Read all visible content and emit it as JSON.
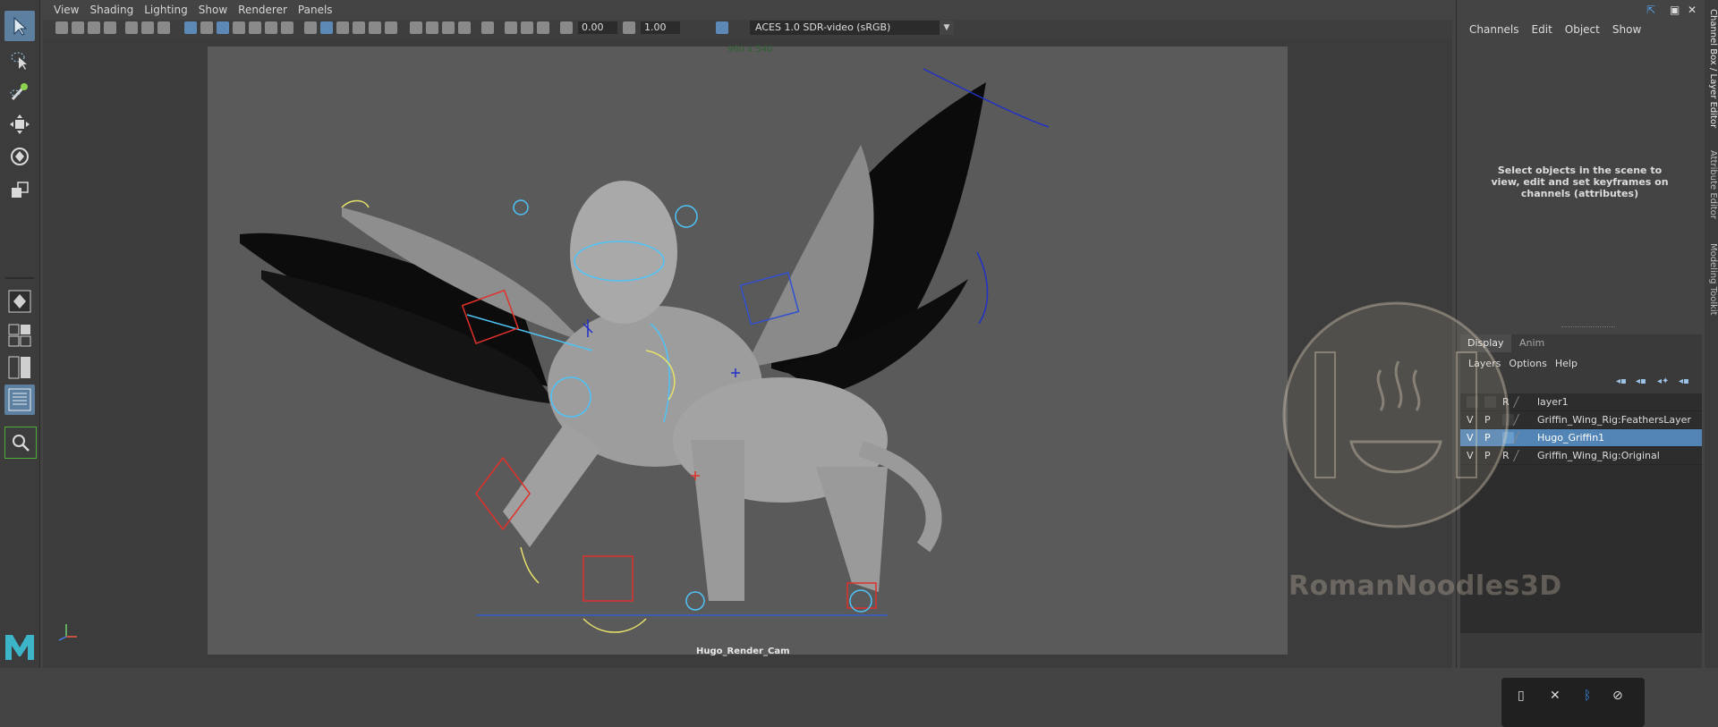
{
  "app": {
    "name": "Maya"
  },
  "viewport": {
    "menu": [
      "View",
      "Shading",
      "Lighting",
      "Show",
      "Renderer",
      "Panels"
    ],
    "toolbar": {
      "exposure": "0.00",
      "gamma": "1.00",
      "color_space": "ACES 1.0 SDR-video (sRGB)"
    },
    "resolution_label": "960 x 540",
    "camera_label": "Hugo_Render_Cam"
  },
  "toolbox": {
    "tools": [
      "select-tool",
      "lasso-tool",
      "paint-select-tool",
      "move-tool",
      "rotate-tool",
      "scale-tool"
    ],
    "layouts": [
      "single-pane-layout",
      "four-pane-layout",
      "two-pane-side-layout",
      "outliner-layout"
    ],
    "search_icon": "search-icon"
  },
  "channel_box": {
    "menu": [
      "Channels",
      "Edit",
      "Object",
      "Show"
    ],
    "hint": "Select objects in the scene to view, edit and set keyframes on channels (attributes)"
  },
  "layer_editor": {
    "tabs": [
      "Display",
      "Anim"
    ],
    "active_tab": "Display",
    "menu": [
      "Layers",
      "Options",
      "Help"
    ],
    "layers": [
      {
        "v": "",
        "p": "",
        "r": "R",
        "name": "layer1",
        "selected": false
      },
      {
        "v": "V",
        "p": "P",
        "r": "",
        "name": "Griffin_Wing_Rig:FeathersLayer",
        "selected": false
      },
      {
        "v": "V",
        "p": "P",
        "r": "",
        "name": "Hugo_Griffin1",
        "selected": true
      },
      {
        "v": "V",
        "p": "P",
        "r": "R",
        "name": "Griffin_Wing_Rig:Original",
        "selected": false
      }
    ]
  },
  "side_tabs": [
    "Channel Box / Layer Editor",
    "Attribute Editor",
    "Modeling Toolkit"
  ],
  "watermark": {
    "text": "RomanNoodles3D"
  },
  "colors": {
    "selection": "#5285b5",
    "rig_blue": "#4fc3f7",
    "rig_red": "#e0302a",
    "rig_yellow": "#e8e26a",
    "accent_green": "#4fae3b"
  }
}
